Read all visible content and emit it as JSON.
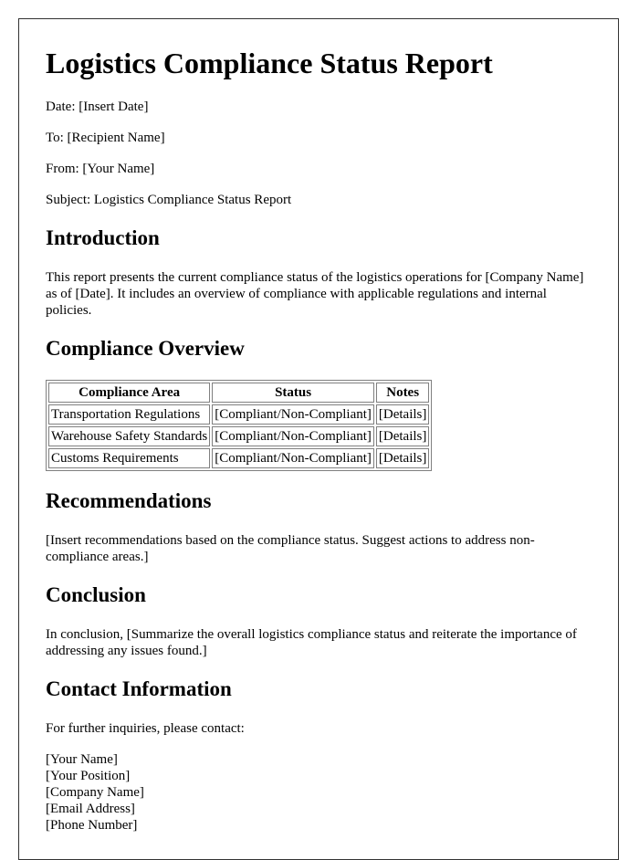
{
  "title": "Logistics Compliance Status Report",
  "meta": {
    "date": "Date: [Insert Date]",
    "to": "To: [Recipient Name]",
    "from": "From: [Your Name]",
    "subject": "Subject: Logistics Compliance Status Report"
  },
  "introduction": {
    "heading": "Introduction",
    "text": "This report presents the current compliance status of the logistics operations for [Company Name] as of [Date]. It includes an overview of compliance with applicable regulations and internal policies."
  },
  "overview": {
    "heading": "Compliance Overview",
    "columns": [
      "Compliance Area",
      "Status",
      "Notes"
    ],
    "rows": [
      [
        "Transportation Regulations",
        "[Compliant/Non-Compliant]",
        "[Details]"
      ],
      [
        "Warehouse Safety Standards",
        "[Compliant/Non-Compliant]",
        "[Details]"
      ],
      [
        "Customs Requirements",
        "[Compliant/Non-Compliant]",
        "[Details]"
      ]
    ]
  },
  "recommendations": {
    "heading": "Recommendations",
    "text": "[Insert recommendations based on the compliance status. Suggest actions to address non-compliance areas.]"
  },
  "conclusion": {
    "heading": "Conclusion",
    "text": "In conclusion, [Summarize the overall logistics compliance status and reiterate the importance of addressing any issues found.]"
  },
  "contact": {
    "heading": "Contact Information",
    "intro": "For further inquiries, please contact:",
    "lines": [
      "[Your Name]",
      "[Your Position]",
      "[Company Name]",
      "[Email Address]",
      "[Phone Number]"
    ]
  }
}
